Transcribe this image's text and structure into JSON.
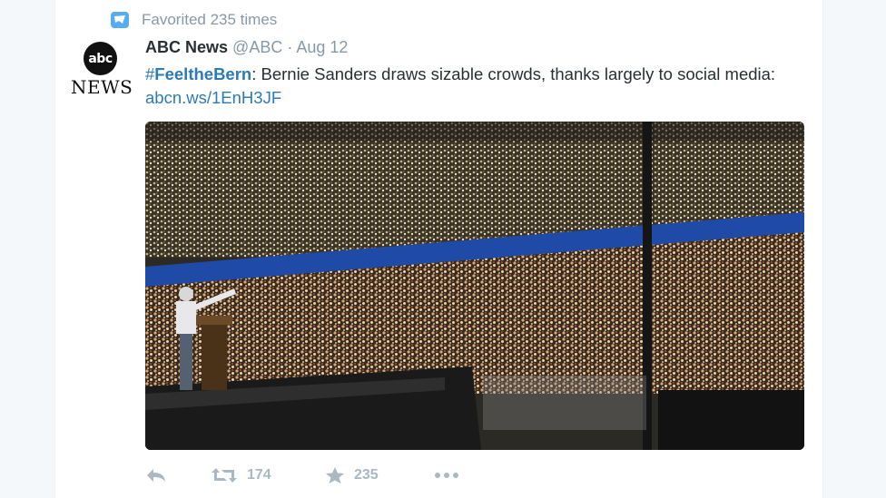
{
  "context": {
    "icon": "favorite-badge-icon",
    "text": "Favorited 235 times"
  },
  "author": {
    "avatar_circle": "abc",
    "avatar_word": "NEWS",
    "name": "ABC News",
    "handle": "@ABC",
    "separator": "·",
    "date": "Aug 12"
  },
  "tweet": {
    "hashtag_symbol": "#",
    "hashtag_word": "FeeltheBern",
    "text": ": Bernie Sanders draws sizable crowds, thanks largely to social media: ",
    "link": "abcn.ws/1EnH3JF"
  },
  "actions": {
    "reply_icon": "reply-icon",
    "retweet_icon": "retweet-icon",
    "retweet_count": "174",
    "favorite_icon": "star-icon",
    "favorite_count": "235",
    "more_icon": "more-dots-icon"
  },
  "colors": {
    "link": "#2b7bb9",
    "muted": "#8899a6",
    "action": "#aab8c2",
    "badge": "#55acee",
    "stage_wall": "#1f4aa8"
  }
}
